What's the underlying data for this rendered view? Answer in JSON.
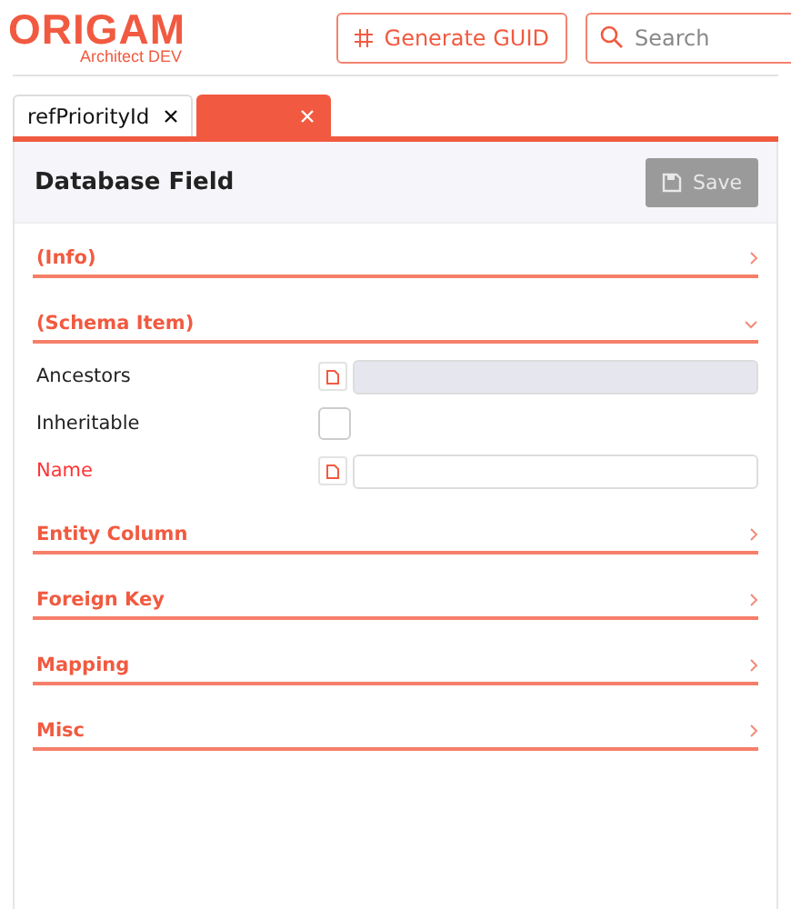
{
  "header": {
    "logo": "ORIGAM",
    "logo_subtitle": "Architect DEV",
    "generate_button": "Generate GUID",
    "search": {
      "placeholder": "Search"
    }
  },
  "tabs": [
    {
      "label": "refPriorityId",
      "selected": false
    },
    {
      "selected": true
    }
  ],
  "editor": {
    "title": "Database Field",
    "save_button": {
      "label": "Save",
      "disabled": true
    },
    "sections": [
      {
        "title": "(Info)",
        "expanded": false
      },
      {
        "title": "(Schema Item)",
        "expanded": true,
        "properties": [
          {
            "kind": "text",
            "label": "Ancestors",
            "required": false,
            "disabled": true
          },
          {
            "kind": "checkbox",
            "label": "Inheritable",
            "required": false,
            "checked": false
          },
          {
            "kind": "text",
            "label": "Name",
            "required": true,
            "disabled": false
          }
        ]
      },
      {
        "title": "Entity Column",
        "expanded": false
      },
      {
        "title": "Foreign Key",
        "expanded": false
      },
      {
        "title": "Mapping",
        "expanded": false
      },
      {
        "title": "Misc",
        "expanded": false
      }
    ]
  }
}
